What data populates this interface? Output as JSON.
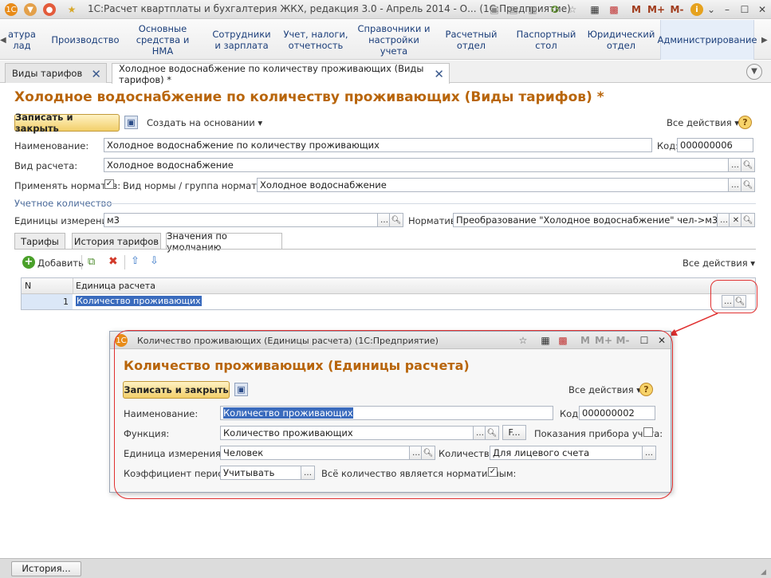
{
  "app": {
    "window_title": "1С:Расчет квартплаты и бухгалтерия ЖКХ, редакция 3.0 - Апрель 2014 - О... (1С:Предприятие)",
    "title_icons": [
      "m-icon",
      "m-plus-icon",
      "m-minus-icon",
      "info-icon",
      "minimize-icon",
      "maximize-icon",
      "close-icon"
    ],
    "title_icon_text": {
      "m": "M",
      "mplus": "M+",
      "mminus": "M-",
      "info": "i"
    }
  },
  "menu": {
    "items": [
      {
        "label": "атура\nлад"
      },
      {
        "label": "Производство"
      },
      {
        "label": "Основные\nсредства и НМА"
      },
      {
        "label": "Сотрудники\nи зарплата"
      },
      {
        "label": "Учет, налоги,\nотчетность"
      },
      {
        "label": "Справочники и\nнастройки учета"
      },
      {
        "label": "Расчетный\nотдел"
      },
      {
        "label": "Паспортный\nстол"
      },
      {
        "label": "Юридический\nотдел"
      },
      {
        "label": "Администрирование"
      }
    ]
  },
  "tabs": [
    {
      "label": "Виды тарифов"
    },
    {
      "label": "Холодное водоснабжение по количеству проживающих (Виды тарифов) *"
    }
  ],
  "form": {
    "title": "Холодное водоснабжение по количеству проживающих (Виды тарифов) *",
    "save_close": "Записать и закрыть",
    "create_based": "Создать на основании",
    "all_actions": "Все действия",
    "help": "?",
    "name_label": "Наименование:",
    "name_value": "Холодное водоснабжение по количеству проживающих",
    "code_label": "Код:",
    "code_value": "000000006",
    "calc_type_label": "Вид расчета:",
    "calc_type_value": "Холодное водоснабжение",
    "apply_norm_label": "Применять норматив:",
    "apply_norm_checked": "✓",
    "norm_group_label": "Вид нормы / группа нормативов:",
    "norm_group_value": "Холодное водоснабжение",
    "section_label": "Учетное количество",
    "units_label": "Единицы измерения:",
    "units_value": "м3",
    "norm_label": "Норматив:",
    "norm_value": "Преобразование \"Холодное водоснабжение\" чел->м3"
  },
  "subtabs": [
    {
      "label": "Тарифы"
    },
    {
      "label": "История тарифов"
    },
    {
      "label": "Значения по умолчанию"
    }
  ],
  "grid_toolbar": {
    "add": "Добавить",
    "all_actions": "Все действия"
  },
  "grid": {
    "headers": [
      "N",
      "Единица расчета"
    ],
    "rows": [
      {
        "n": "1",
        "unit": "Количество проживающих"
      }
    ]
  },
  "modal": {
    "window_title": "Количество проживающих (Единицы расчета)  (1С:Предприятие)",
    "title": "Количество проживающих (Единицы расчета)",
    "save_close": "Записать и закрыть",
    "all_actions": "Все действия",
    "help": "?",
    "name_label": "Наименование:",
    "name_value": "Количество проживающих",
    "code_label": "Код:",
    "code_value": "000000002",
    "function_label": "Функция:",
    "function_value": "Количество проживающих",
    "f_button": "F...",
    "meter_label": "Показания прибора учета:",
    "unit_label": "Единица измерения:",
    "unit_value": "Человек",
    "qty_label": "Количество:",
    "qty_value": "Для лицевого счета",
    "coef_label": "Коэффициент периода:",
    "coef_value": "Учитывать",
    "all_norm_label": "Всё количество является нормативным:",
    "all_norm_checked": "✓"
  },
  "status": {
    "history": "История..."
  },
  "colors": {
    "accent_title": "#b8650a",
    "link_blue": "#1b3e7a",
    "selection": "#3a6bbd",
    "highlight_red": "#e03030"
  }
}
